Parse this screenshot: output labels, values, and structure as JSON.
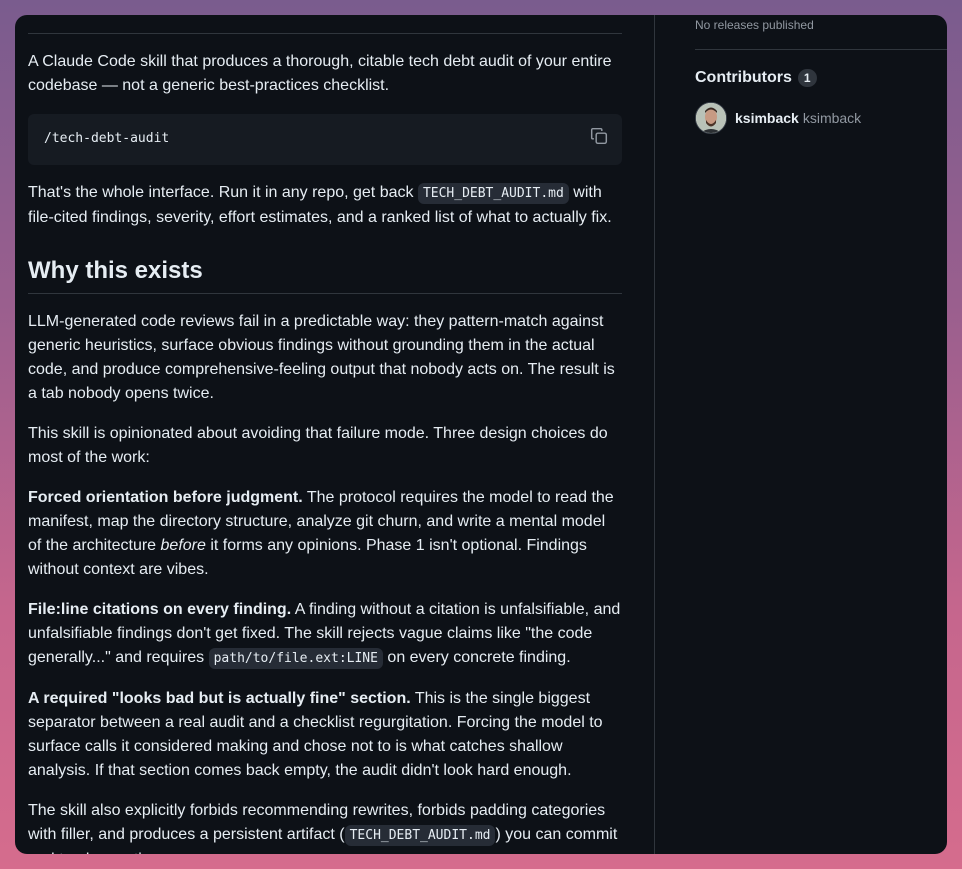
{
  "readme": {
    "intro": "A Claude Code skill that produces a thorough, citable tech debt audit of your entire codebase — not a generic best-practices checklist.",
    "command": "/tech-debt-audit",
    "interface_p": {
      "before": "That's the whole interface. Run it in any repo, get back ",
      "code": "TECH_DEBT_AUDIT.md",
      "after": " with file-cited findings, severity, effort estimates, and a ranked list of what to actually fix."
    },
    "why_heading": "Why this exists",
    "why_p1": "LLM-generated code reviews fail in a predictable way: they pattern-match against generic heuristics, surface obvious findings without grounding them in the actual code, and produce comprehensive-feeling output that nobody acts on. The result is a tab nobody opens twice.",
    "why_p2": "This skill is opinionated about avoiding that failure mode. Three design choices do most of the work:",
    "choice1": {
      "bold": "Forced orientation before judgment.",
      "text1": " The protocol requires the model to read the manifest, map the directory structure, analyze git churn, and write a mental model of the architecture ",
      "em": "before",
      "text2": " it forms any opinions. Phase 1 isn't optional. Findings without context are vibes."
    },
    "choice2": {
      "bold": "File:line citations on every finding.",
      "text1": " A finding without a citation is unfalsifiable, and unfalsifiable findings don't get fixed. The skill rejects vague claims like \"the code generally...\" and requires ",
      "code": "path/to/file.ext:LINE",
      "text2": " on every concrete finding."
    },
    "choice3": {
      "bold": "A required \"looks bad but is actually fine\" section.",
      "text": " This is the single biggest separator between a real audit and a checklist regurgitation. Forcing the model to surface calls it considered making and chose not to is what catches shallow analysis. If that section comes back empty, the audit didn't look hard enough."
    },
    "final_p": {
      "before": "The skill also explicitly forbids recommending rewrites, forbids padding categories with filler, and produces a persistent artifact (",
      "code": "TECH_DEBT_AUDIT.md",
      "after": ") you can commit and track over time."
    }
  },
  "sidebar": {
    "releases_text": "No releases published",
    "contributors_heading": "Contributors",
    "contributors_count": "1",
    "contributors": [
      {
        "login": "ksimback",
        "name": "ksimback"
      }
    ]
  },
  "icons": {
    "copy": "copy-icon",
    "avatar": "avatar-image"
  },
  "colors": {
    "background": "#0d1117",
    "text": "#e6edf3",
    "muted": "#9198a1",
    "border": "#30363d",
    "code_bg": "#161b22"
  }
}
